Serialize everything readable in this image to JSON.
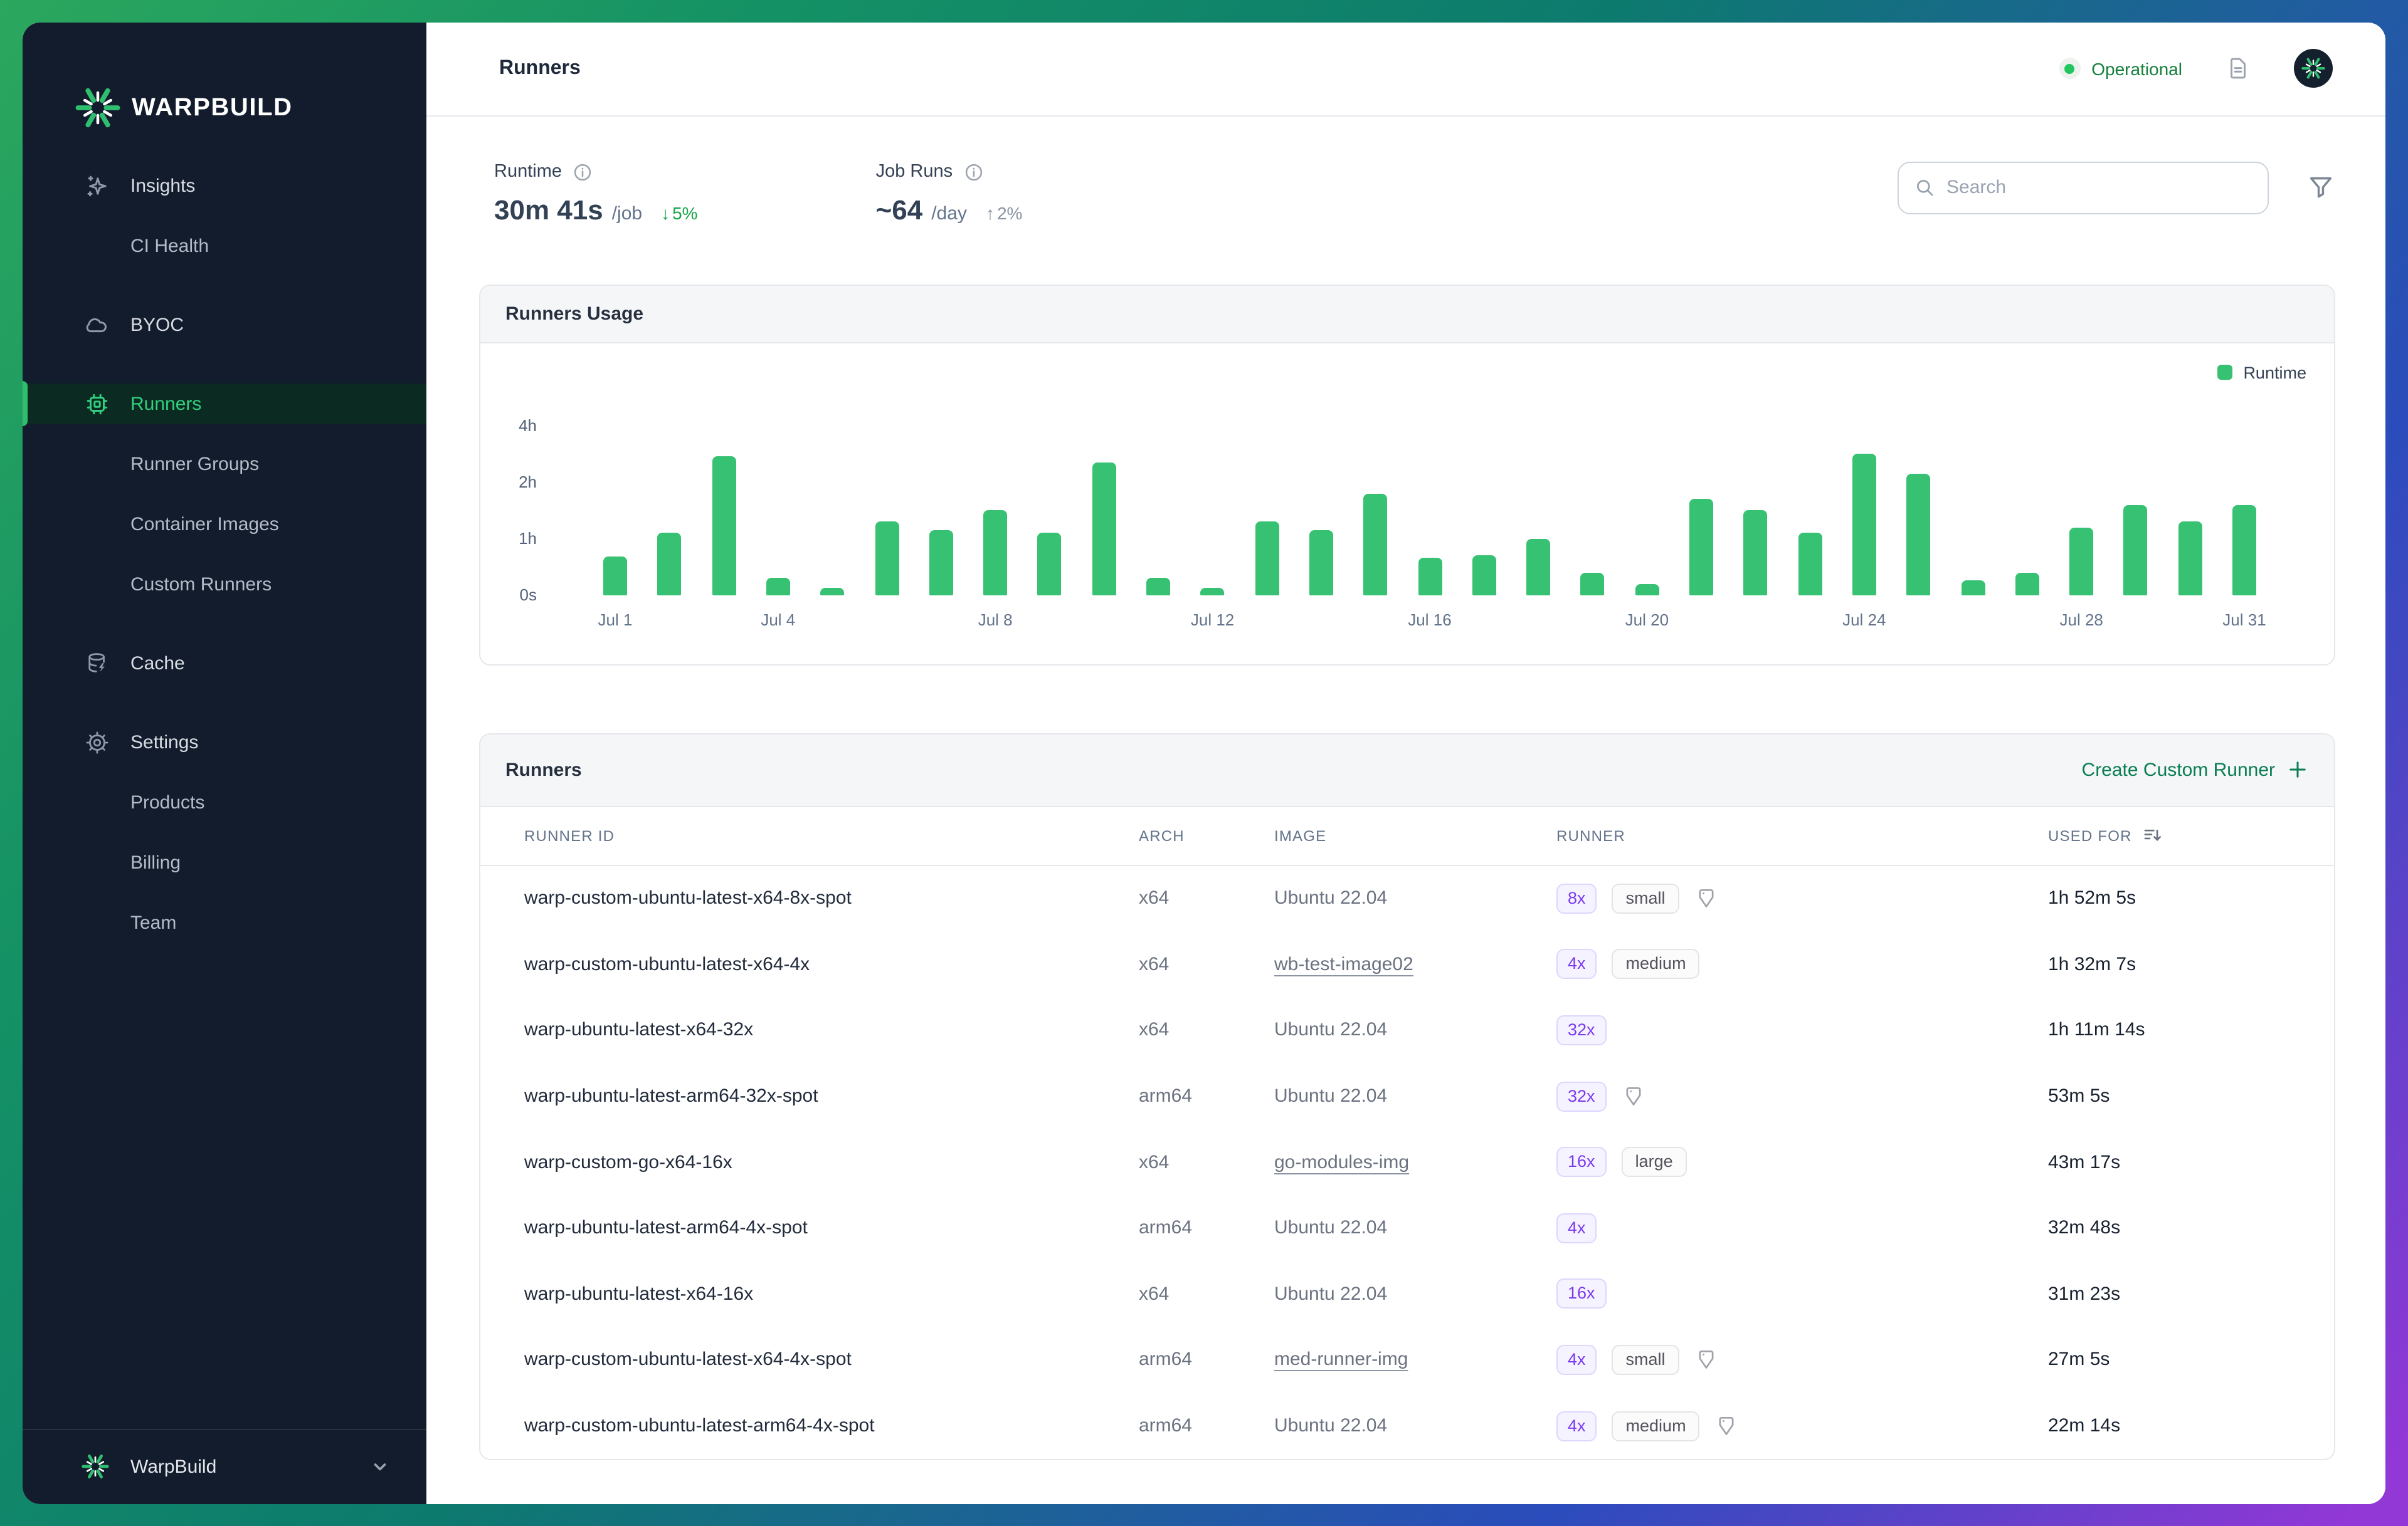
{
  "app": {
    "brand": "WARPBUILD"
  },
  "sidebar": {
    "items": [
      {
        "label": "Insights",
        "icon": "sparkles",
        "level": 0,
        "active": false,
        "section_gap": false
      },
      {
        "label": "CI Health",
        "icon": null,
        "level": 1,
        "active": false,
        "section_gap": false
      },
      {
        "label": "BYOC",
        "icon": "cloud",
        "level": 0,
        "active": false,
        "section_gap": true
      },
      {
        "label": "Runners",
        "icon": "cpu",
        "level": 0,
        "active": true,
        "section_gap": true
      },
      {
        "label": "Runner Groups",
        "icon": null,
        "level": 1,
        "active": false,
        "section_gap": false
      },
      {
        "label": "Container Images",
        "icon": null,
        "level": 1,
        "active": false,
        "section_gap": false
      },
      {
        "label": "Custom Runners",
        "icon": null,
        "level": 1,
        "active": false,
        "section_gap": false
      },
      {
        "label": "Cache",
        "icon": "database",
        "level": 0,
        "active": false,
        "section_gap": true
      },
      {
        "label": "Settings",
        "icon": "gear",
        "level": 0,
        "active": false,
        "section_gap": true
      },
      {
        "label": "Products",
        "icon": null,
        "level": 1,
        "active": false,
        "section_gap": false
      },
      {
        "label": "Billing",
        "icon": null,
        "level": 1,
        "active": false,
        "section_gap": false
      },
      {
        "label": "Team",
        "icon": null,
        "level": 1,
        "active": false,
        "section_gap": false
      }
    ],
    "org": {
      "name": "WarpBuild"
    }
  },
  "topbar": {
    "title": "Runners",
    "status": "Operational"
  },
  "stats": {
    "runtime": {
      "label": "Runtime",
      "value": "30m 41s",
      "unit": "/job",
      "arrow": "↓",
      "delta": "5%",
      "direction": "down"
    },
    "job_runs": {
      "label": "Job Runs",
      "value": "~64",
      "unit": "/day",
      "arrow": "↑",
      "delta": "2%",
      "direction": "up"
    }
  },
  "search": {
    "placeholder": "Search"
  },
  "usage_card": {
    "title": "Runners Usage",
    "legend": "Runtime"
  },
  "chart_data": {
    "type": "bar",
    "title": "Runners Usage",
    "series_name": "Runtime",
    "categories": [
      "Jul 1",
      "Jul 2",
      "Jul 3",
      "Jul 4",
      "Jul 5",
      "Jul 6",
      "Jul 7",
      "Jul 8",
      "Jul 9",
      "Jul 10",
      "Jul 11",
      "Jul 12",
      "Jul 13",
      "Jul 14",
      "Jul 15",
      "Jul 16",
      "Jul 17",
      "Jul 18",
      "Jul 19",
      "Jul 20",
      "Jul 21",
      "Jul 22",
      "Jul 23",
      "Jul 24",
      "Jul 25",
      "Jul 26",
      "Jul 27",
      "Jul 28",
      "Jul 29",
      "Jul 30",
      "Jul 31"
    ],
    "values_hours": [
      0.67,
      1.1,
      2.9,
      0.3,
      0.12,
      1.3,
      1.15,
      1.5,
      1.1,
      2.7,
      0.3,
      0.12,
      1.3,
      1.15,
      1.8,
      0.65,
      0.7,
      1.0,
      0.4,
      0.2,
      1.7,
      1.5,
      1.1,
      3.0,
      2.3,
      0.25,
      0.4,
      1.2,
      1.6,
      1.3,
      1.6
    ],
    "y_ticks": [
      "0s",
      "1h",
      "2h",
      "4h"
    ],
    "y_scale_note": "ticks 0s/1h/2h/4h are evenly spaced (doubling scale)",
    "x_ticks_shown": [
      {
        "label": "Jul 1",
        "index": 0
      },
      {
        "label": "Jul 4",
        "index": 3
      },
      {
        "label": "Jul 8",
        "index": 7
      },
      {
        "label": "Jul 12",
        "index": 11
      },
      {
        "label": "Jul 16",
        "index": 15
      },
      {
        "label": "Jul 20",
        "index": 19
      },
      {
        "label": "Jul 24",
        "index": 23
      },
      {
        "label": "Jul 28",
        "index": 27
      },
      {
        "label": "Jul 31",
        "index": 30
      }
    ],
    "legend": "Runtime",
    "legend_position": "top-right",
    "grid": false,
    "bar_color": "#37c172"
  },
  "runners_card": {
    "title": "Runners",
    "create_label": "Create Custom Runner",
    "columns": [
      "RUNNER ID",
      "ARCH",
      "IMAGE",
      "RUNNER",
      "USED FOR"
    ],
    "rows": [
      {
        "id": "warp-custom-ubuntu-latest-x64-8x-spot",
        "arch": "x64",
        "image": "Ubuntu 22.04",
        "image_link": false,
        "multiplier": "8x",
        "size": "small",
        "tag": true,
        "used_for": "1h 52m 5s"
      },
      {
        "id": "warp-custom-ubuntu-latest-x64-4x",
        "arch": "x64",
        "image": "wb-test-image02",
        "image_link": true,
        "multiplier": "4x",
        "size": "medium",
        "tag": false,
        "used_for": "1h 32m 7s"
      },
      {
        "id": "warp-ubuntu-latest-x64-32x",
        "arch": "x64",
        "image": "Ubuntu 22.04",
        "image_link": false,
        "multiplier": "32x",
        "size": null,
        "tag": false,
        "used_for": "1h 11m 14s"
      },
      {
        "id": "warp-ubuntu-latest-arm64-32x-spot",
        "arch": "arm64",
        "image": "Ubuntu 22.04",
        "image_link": false,
        "multiplier": "32x",
        "size": null,
        "tag": true,
        "used_for": "53m 5s"
      },
      {
        "id": "warp-custom-go-x64-16x",
        "arch": "x64",
        "image": "go-modules-img",
        "image_link": true,
        "multiplier": "16x",
        "size": "large",
        "tag": false,
        "used_for": "43m 17s"
      },
      {
        "id": "warp-ubuntu-latest-arm64-4x-spot",
        "arch": "arm64",
        "image": "Ubuntu 22.04",
        "image_link": false,
        "multiplier": "4x",
        "size": null,
        "tag": false,
        "used_for": "32m 48s"
      },
      {
        "id": "warp-ubuntu-latest-x64-16x",
        "arch": "x64",
        "image": "Ubuntu 22.04",
        "image_link": false,
        "multiplier": "16x",
        "size": null,
        "tag": false,
        "used_for": "31m 23s"
      },
      {
        "id": "warp-custom-ubuntu-latest-x64-4x-spot",
        "arch": "arm64",
        "image": "med-runner-img",
        "image_link": true,
        "multiplier": "4x",
        "size": "small",
        "tag": true,
        "used_for": "27m 5s"
      },
      {
        "id": "warp-custom-ubuntu-latest-arm64-4x-spot",
        "arch": "arm64",
        "image": "Ubuntu 22.04",
        "image_link": false,
        "multiplier": "4x",
        "size": "medium",
        "tag": true,
        "used_for": "22m 14s"
      }
    ]
  },
  "colors": {
    "accent_green": "#2fbe6e",
    "bar_green": "#37c172",
    "status_green": "#15803d",
    "badge_purple": "#7c3aed",
    "sidebar_bg": "#131c2d",
    "frame_gradient": [
      "#2ba75e",
      "#149165",
      "#0d7a6e",
      "#2b4cbc",
      "#9138d6"
    ]
  }
}
